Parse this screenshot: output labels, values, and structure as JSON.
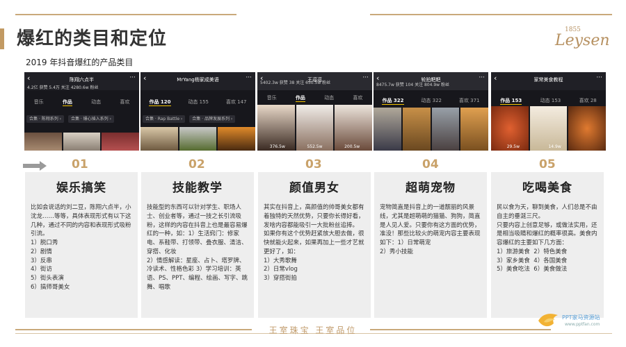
{
  "title": "爆红的类目和定位",
  "subtitle": "2019 年抖音爆红的产品类目",
  "brand": {
    "name": "Leysen",
    "year": "1855"
  },
  "footer": "王室珠宝  王室品位",
  "watermark": {
    "line1": "PPT家马资源站",
    "line2": "www.pptfan.com"
  },
  "colors": {
    "accent": "#c29a63",
    "number": "#c9a26a",
    "card_bg": "#eeeeee"
  },
  "screenshots": [
    {
      "name": "陈翔六点半",
      "stats": "4.2亿 获赞   5.4万 关注   4280.6w 粉丝",
      "tabs": [
        "音乐",
        "作品",
        "动态",
        "喜欢"
      ],
      "tags": [
        "合集 · 陈翔系列 ›",
        "合集 · 爆心插入系列 ›"
      ],
      "counts": [
        "",
        "",
        ""
      ]
    },
    {
      "name": "MrYang杨家成美语",
      "stats": "",
      "tabs": [
        "作品 120",
        "动态 155",
        "喜欢 147"
      ],
      "tags": [
        "合集 · Rap Battle ›",
        "合集 · 品牌发展系列 ›"
      ],
      "counts": [
        "",
        "",
        ""
      ]
    },
    {
      "name": "王逗逗",
      "stats": "5402.3w 获赞   38 关注   650.5w 粉丝",
      "tabs": [
        "音乐",
        "作品",
        "动态",
        "喜欢"
      ],
      "tags": [],
      "counts": [
        "376.5w",
        "552.5w",
        "200.5w"
      ]
    },
    {
      "name": "轮拍粑粑",
      "stats": "8475.7w 获赞   104 关注   804.9w 粉丝",
      "tabs": [
        "作品 322",
        "动态 322",
        "喜欢 371"
      ],
      "tags": [],
      "counts": [
        "",
        "",
        ""
      ]
    },
    {
      "name": "家常美食教程",
      "stats": "",
      "tabs": [
        "作品 153",
        "动态 153",
        "喜欢 28"
      ],
      "tags": [],
      "counts": [
        "29.5w",
        "14.9w",
        ""
      ]
    }
  ],
  "categories": [
    {
      "number": "01",
      "title": "娱乐搞笑",
      "body": "比如会说话的刘二豆，陈翔六点半，小沈龙……等等，具体表现形式有以下这几种，通过不同的内容和表现形式吸粉引流。\n1）脱口秀\n2）剧情\n3）反串\n4）街访\n5）街头表演\n6）搞师哥美女"
    },
    {
      "number": "02",
      "title": "技能教学",
      "body": "技能型的东西可以针对学生、职场人士、创业者等，通过一技之长引流吸粉，这样的内容在抖音上也是最容易爆红的一种，如：1）生活窍门：修家电、系鞋带、打领带、叠衣服、清洁、穿搭、化妆\n2）情感解读：星座、占卜、塔罗牌、冷读术、性格色彩 3）学习培训：英语、PS、PPT、编程、绘画、写字、跳舞、唱歌"
    },
    {
      "number": "03",
      "title": "颜值男女",
      "body": "其实在抖音上，高颜值的帅哥美女都有着独特的天然优势，只要你长得好看，发啥内容都能吸引一大批粉丝追捧。\n如果你有这个优势赶紧放大胆去做，很快就能火起来，如果再加上一些才艺就更好了，如：\n1）大秀歌舞\n2）日常vlog\n3）穿搭街拍"
    },
    {
      "number": "04",
      "title": "超萌宠物",
      "body": "宠物简直是抖音上的一道靓丽的风景线，尤其是超萌萌的猫猫、狗狗，简直是人见人爱。只要你有这方面的优势，准没！那些比较火的萌宠内容主要表现如下：1）日常萌宠\n2）秀小技能"
    },
    {
      "number": "05",
      "title": "吃喝美食",
      "body": "民以食为天，聊到美食，人们总是不由自主的垂涎三尺。\n只要内容上创意足够，或做法实用，还是相当吸睛和爆红的概率很高。美食内容爆红的主要如下几方面：\n1）旅游美食  2）特色美食\n3）家乡美食  4）各国美食\n5）美食吃法  6）美食做法"
    }
  ]
}
